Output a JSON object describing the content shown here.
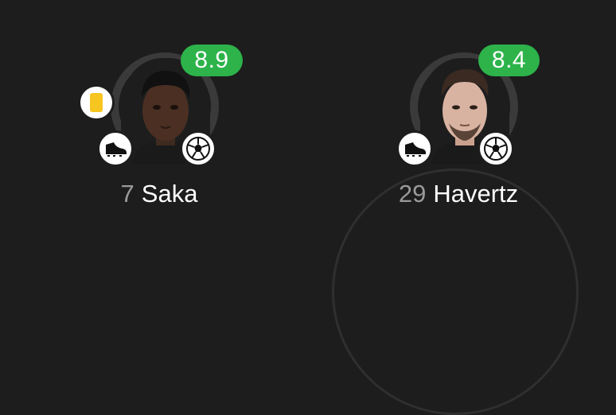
{
  "players": [
    {
      "number": "7",
      "name": "Saka",
      "rating": "8.9",
      "rating_color": "#2db34a",
      "events": [
        "yellow-card-icon",
        "football-boot-icon",
        "football-icon"
      ],
      "card_color": "#f7c51f"
    },
    {
      "number": "29",
      "name": "Havertz",
      "rating": "8.4",
      "rating_color": "#2db34a",
      "events": [
        "football-boot-icon",
        "football-icon"
      ]
    }
  ]
}
